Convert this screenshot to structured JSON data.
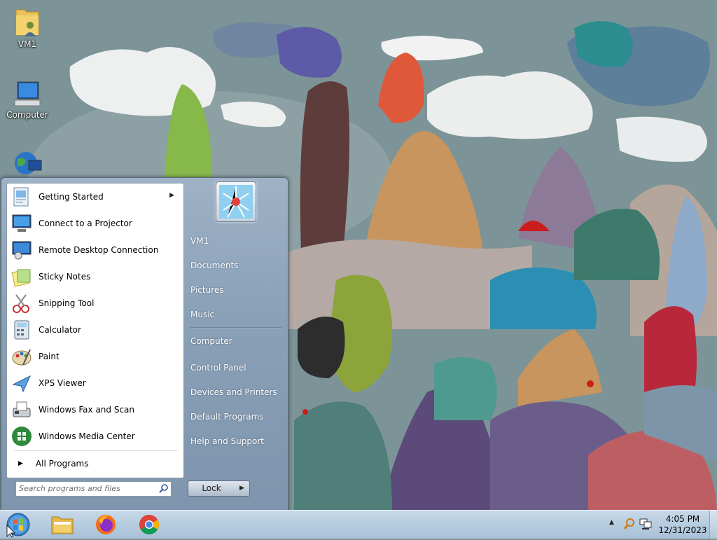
{
  "desktop": {
    "icons": [
      {
        "label": "VM1",
        "icon": "user-folder-icon"
      },
      {
        "label": "Computer",
        "icon": "computer-icon"
      },
      {
        "label": "",
        "icon": "network-icon"
      }
    ]
  },
  "start_menu": {
    "programs": [
      {
        "label": "Getting Started",
        "icon": "getting-started-icon",
        "has_submenu": true
      },
      {
        "label": "Connect to a Projector",
        "icon": "projector-icon"
      },
      {
        "label": "Remote Desktop Connection",
        "icon": "remote-desktop-icon"
      },
      {
        "label": "Sticky Notes",
        "icon": "sticky-notes-icon"
      },
      {
        "label": "Snipping Tool",
        "icon": "scissors-icon"
      },
      {
        "label": "Calculator",
        "icon": "calculator-icon"
      },
      {
        "label": "Paint",
        "icon": "paint-palette-icon"
      },
      {
        "label": "XPS Viewer",
        "icon": "xps-viewer-icon"
      },
      {
        "label": "Windows Fax and Scan",
        "icon": "fax-icon"
      },
      {
        "label": "Windows Media Center",
        "icon": "media-center-icon"
      }
    ],
    "all_programs_label": "All Programs",
    "search_placeholder": "Search programs and files",
    "right_items": [
      {
        "label": "VM1"
      },
      {
        "label": "Documents"
      },
      {
        "label": "Pictures"
      },
      {
        "label": "Music"
      },
      {
        "label": "Computer"
      },
      {
        "label": "Control Panel"
      },
      {
        "label": "Devices and Printers"
      },
      {
        "label": "Default Programs"
      },
      {
        "label": "Help and Support"
      }
    ],
    "lock_label": "Lock"
  },
  "taskbar": {
    "pinned": [
      {
        "name": "file-explorer",
        "icon": "folder-icon"
      },
      {
        "name": "firefox",
        "icon": "firefox-icon"
      },
      {
        "name": "chrome",
        "icon": "chrome-icon"
      }
    ],
    "clock": {
      "time": "4:05 PM",
      "date": "12/31/2023"
    }
  },
  "colors": {
    "taskbar": "#b7cde0",
    "start_menu_frame": "#8aa1b8",
    "accent": "#2b7cd3"
  }
}
